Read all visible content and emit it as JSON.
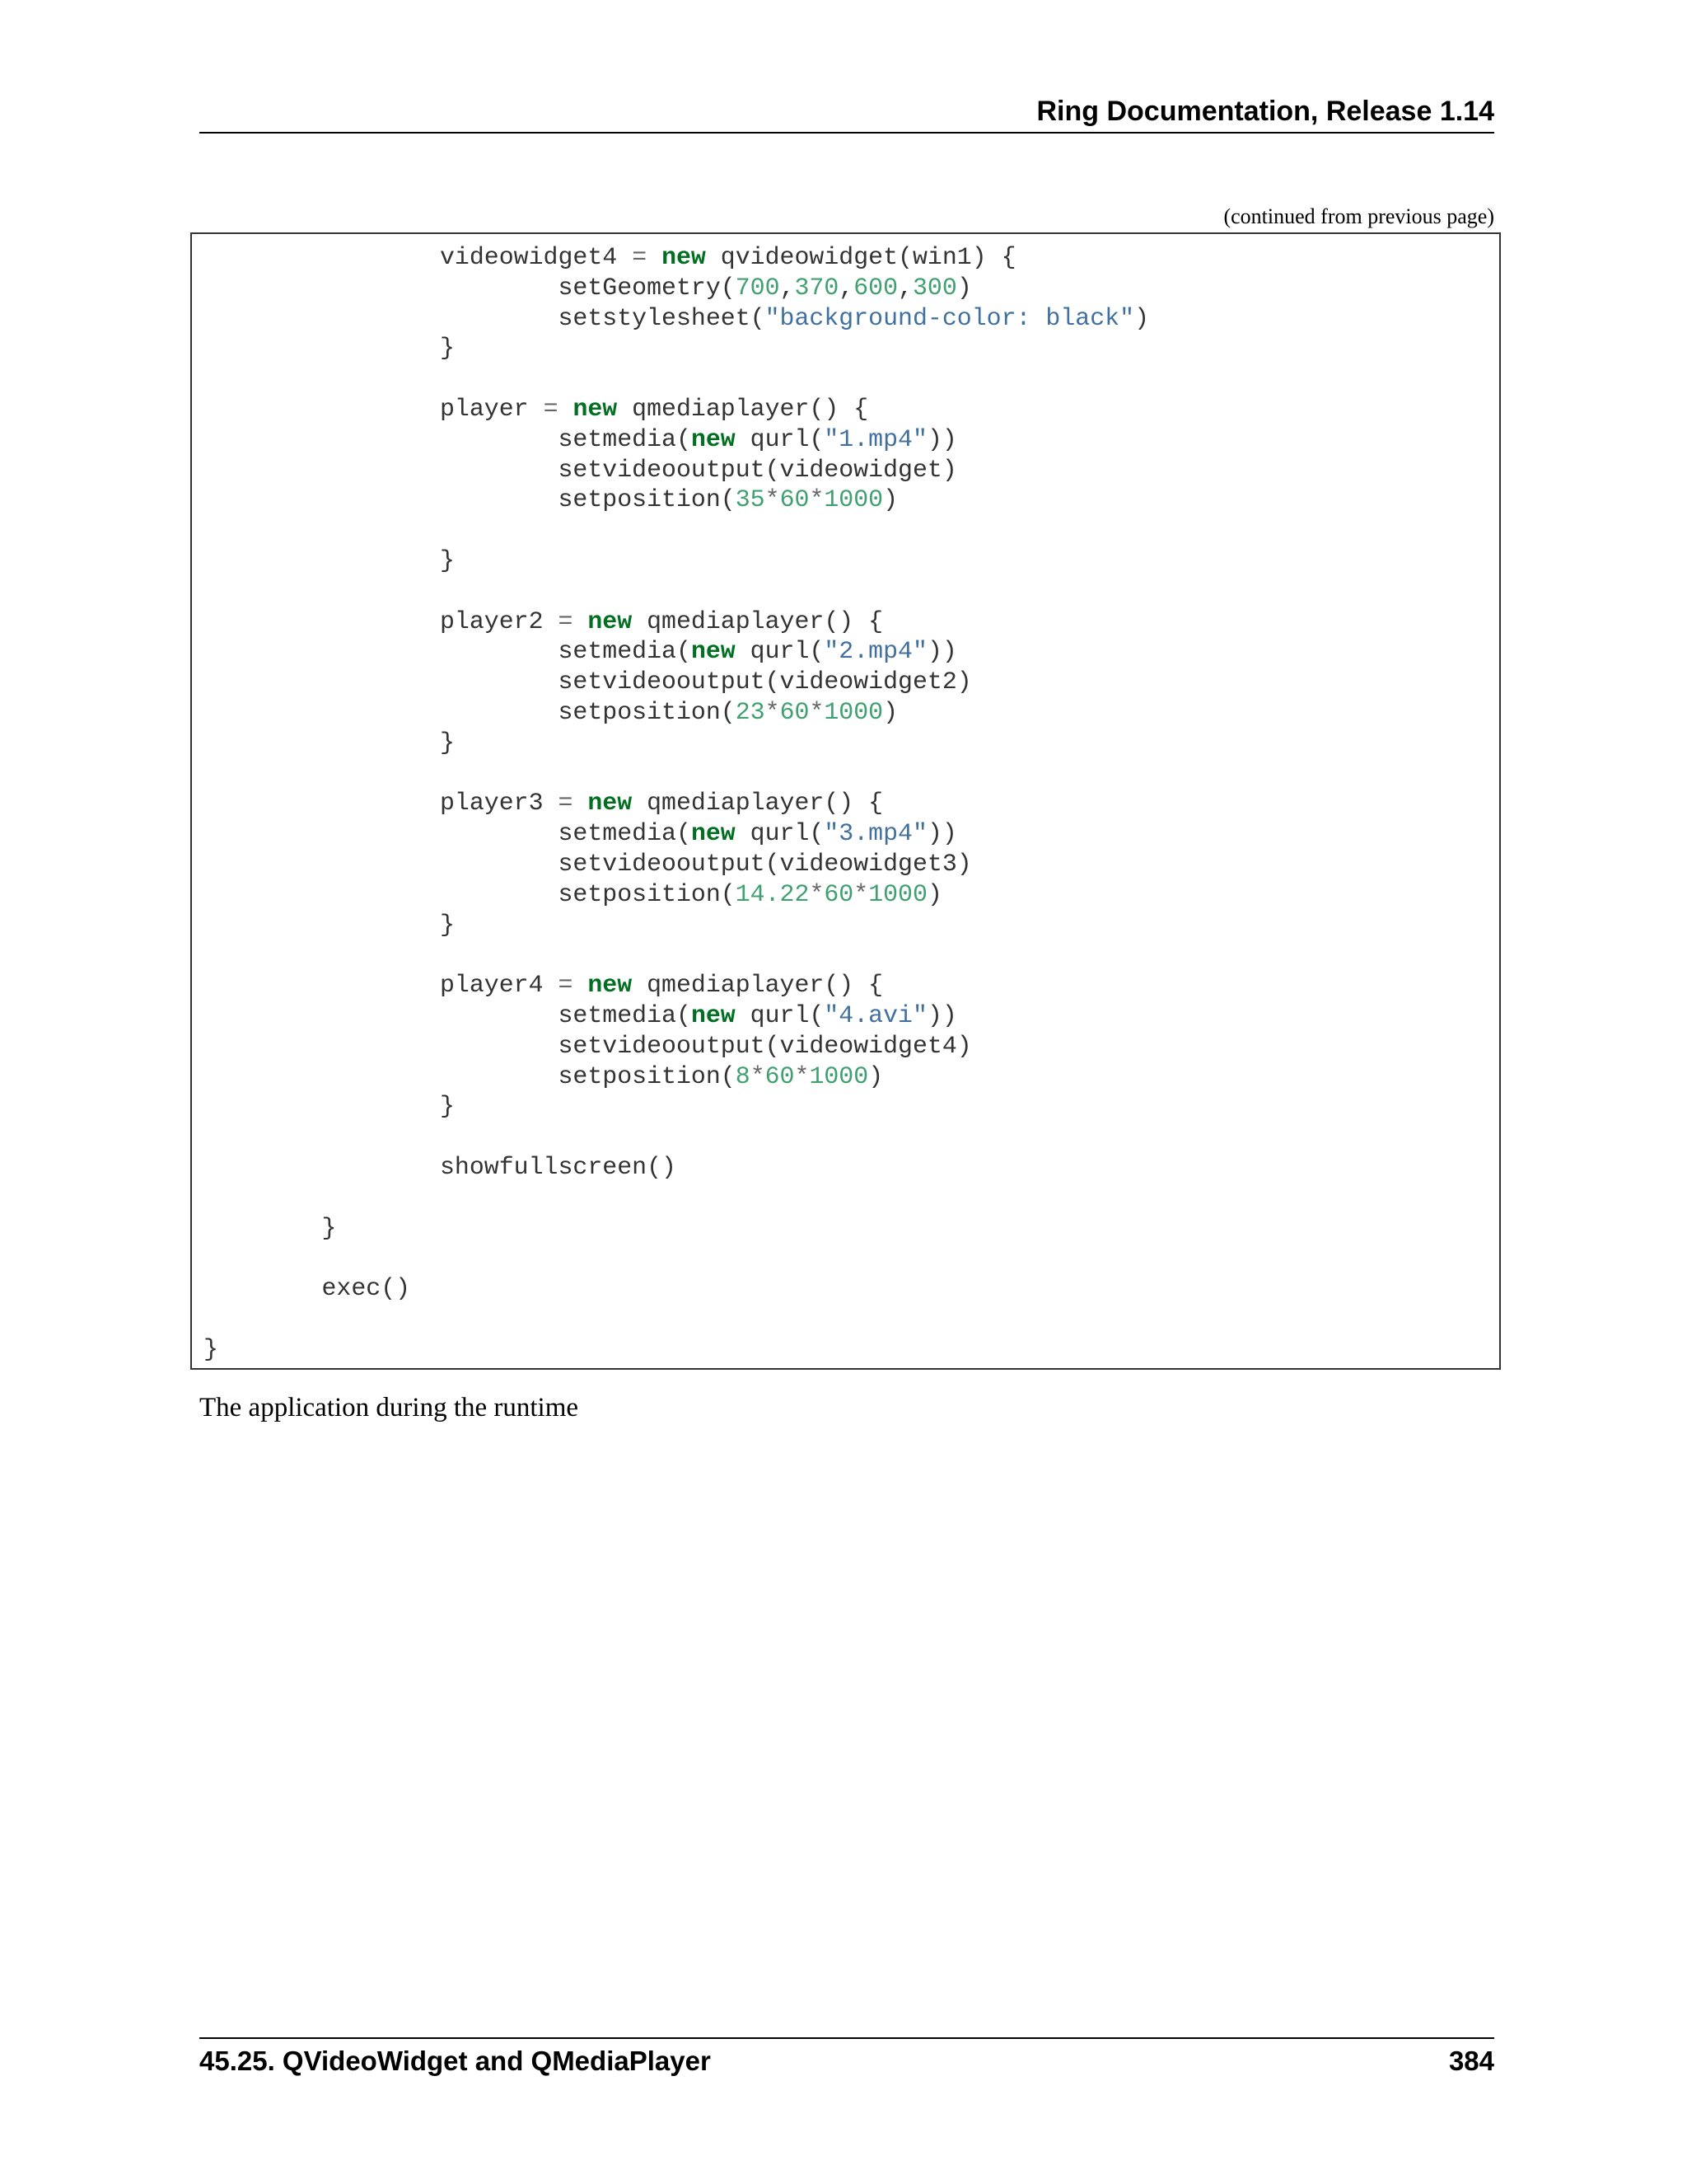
{
  "header": {
    "title": "Ring Documentation, Release 1.14"
  },
  "continued_note": "(continued from previous page)",
  "code": {
    "lines": [
      [
        {
          "t": "\t\tvideowidget4 ",
          "c": ""
        },
        {
          "t": "=",
          "c": "op"
        },
        {
          "t": " ",
          "c": ""
        },
        {
          "t": "new",
          "c": "kw"
        },
        {
          "t": " qvideowidget(win1) {",
          "c": ""
        }
      ],
      [
        {
          "t": "\t\t\tsetGeometry(",
          "c": ""
        },
        {
          "t": "700",
          "c": "num"
        },
        {
          "t": ",",
          "c": ""
        },
        {
          "t": "370",
          "c": "num"
        },
        {
          "t": ",",
          "c": ""
        },
        {
          "t": "600",
          "c": "num"
        },
        {
          "t": ",",
          "c": ""
        },
        {
          "t": "300",
          "c": "num"
        },
        {
          "t": ")",
          "c": ""
        }
      ],
      [
        {
          "t": "\t\t\tsetstylesheet(",
          "c": ""
        },
        {
          "t": "\"background-color: black\"",
          "c": "str"
        },
        {
          "t": ")",
          "c": ""
        }
      ],
      [
        {
          "t": "\t\t}",
          "c": ""
        }
      ],
      [],
      [
        {
          "t": "\t\tplayer ",
          "c": ""
        },
        {
          "t": "=",
          "c": "op"
        },
        {
          "t": " ",
          "c": ""
        },
        {
          "t": "new",
          "c": "kw"
        },
        {
          "t": " qmediaplayer() {",
          "c": ""
        }
      ],
      [
        {
          "t": "\t\t\tsetmedia(",
          "c": ""
        },
        {
          "t": "new",
          "c": "kw"
        },
        {
          "t": " qurl(",
          "c": ""
        },
        {
          "t": "\"1.mp4\"",
          "c": "str"
        },
        {
          "t": "))",
          "c": ""
        }
      ],
      [
        {
          "t": "\t\t\tsetvideooutput(videowidget)",
          "c": ""
        }
      ],
      [
        {
          "t": "\t\t\tsetposition(",
          "c": ""
        },
        {
          "t": "35",
          "c": "num"
        },
        {
          "t": "*",
          "c": "op"
        },
        {
          "t": "60",
          "c": "num"
        },
        {
          "t": "*",
          "c": "op"
        },
        {
          "t": "1000",
          "c": "num"
        },
        {
          "t": ")",
          "c": ""
        }
      ],
      [],
      [
        {
          "t": "\t\t}",
          "c": ""
        }
      ],
      [],
      [
        {
          "t": "\t\tplayer2 ",
          "c": ""
        },
        {
          "t": "=",
          "c": "op"
        },
        {
          "t": " ",
          "c": ""
        },
        {
          "t": "new",
          "c": "kw"
        },
        {
          "t": " qmediaplayer() {",
          "c": ""
        }
      ],
      [
        {
          "t": "\t\t\tsetmedia(",
          "c": ""
        },
        {
          "t": "new",
          "c": "kw"
        },
        {
          "t": " qurl(",
          "c": ""
        },
        {
          "t": "\"2.mp4\"",
          "c": "str"
        },
        {
          "t": "))",
          "c": ""
        }
      ],
      [
        {
          "t": "\t\t\tsetvideooutput(videowidget2)",
          "c": ""
        }
      ],
      [
        {
          "t": "\t\t\tsetposition(",
          "c": ""
        },
        {
          "t": "23",
          "c": "num"
        },
        {
          "t": "*",
          "c": "op"
        },
        {
          "t": "60",
          "c": "num"
        },
        {
          "t": "*",
          "c": "op"
        },
        {
          "t": "1000",
          "c": "num"
        },
        {
          "t": ")",
          "c": ""
        }
      ],
      [
        {
          "t": "\t\t}",
          "c": ""
        }
      ],
      [],
      [
        {
          "t": "\t\tplayer3 ",
          "c": ""
        },
        {
          "t": "=",
          "c": "op"
        },
        {
          "t": " ",
          "c": ""
        },
        {
          "t": "new",
          "c": "kw"
        },
        {
          "t": " qmediaplayer() {",
          "c": ""
        }
      ],
      [
        {
          "t": "\t\t\tsetmedia(",
          "c": ""
        },
        {
          "t": "new",
          "c": "kw"
        },
        {
          "t": " qurl(",
          "c": ""
        },
        {
          "t": "\"3.mp4\"",
          "c": "str"
        },
        {
          "t": "))",
          "c": ""
        }
      ],
      [
        {
          "t": "\t\t\tsetvideooutput(videowidget3)",
          "c": ""
        }
      ],
      [
        {
          "t": "\t\t\tsetposition(",
          "c": ""
        },
        {
          "t": "14.22",
          "c": "num"
        },
        {
          "t": "*",
          "c": "op"
        },
        {
          "t": "60",
          "c": "num"
        },
        {
          "t": "*",
          "c": "op"
        },
        {
          "t": "1000",
          "c": "num"
        },
        {
          "t": ")",
          "c": ""
        }
      ],
      [
        {
          "t": "\t\t}",
          "c": ""
        }
      ],
      [],
      [
        {
          "t": "\t\tplayer4 ",
          "c": ""
        },
        {
          "t": "=",
          "c": "op"
        },
        {
          "t": " ",
          "c": ""
        },
        {
          "t": "new",
          "c": "kw"
        },
        {
          "t": " qmediaplayer() {",
          "c": ""
        }
      ],
      [
        {
          "t": "\t\t\tsetmedia(",
          "c": ""
        },
        {
          "t": "new",
          "c": "kw"
        },
        {
          "t": " qurl(",
          "c": ""
        },
        {
          "t": "\"4.avi\"",
          "c": "str"
        },
        {
          "t": "))",
          "c": ""
        }
      ],
      [
        {
          "t": "\t\t\tsetvideooutput(videowidget4)",
          "c": ""
        }
      ],
      [
        {
          "t": "\t\t\tsetposition(",
          "c": ""
        },
        {
          "t": "8",
          "c": "num"
        },
        {
          "t": "*",
          "c": "op"
        },
        {
          "t": "60",
          "c": "num"
        },
        {
          "t": "*",
          "c": "op"
        },
        {
          "t": "1000",
          "c": "num"
        },
        {
          "t": ")",
          "c": ""
        }
      ],
      [
        {
          "t": "\t\t}",
          "c": ""
        }
      ],
      [],
      [
        {
          "t": "\t\tshowfullscreen()",
          "c": ""
        }
      ],
      [],
      [
        {
          "t": "\t}",
          "c": ""
        }
      ],
      [],
      [
        {
          "t": "\texec()",
          "c": ""
        }
      ],
      [],
      [
        {
          "t": "}",
          "c": ""
        }
      ]
    ]
  },
  "caption": "The application during the runtime",
  "footer": {
    "section": "45.25.  QVideoWidget and QMediaPlayer",
    "page_number": "384"
  }
}
